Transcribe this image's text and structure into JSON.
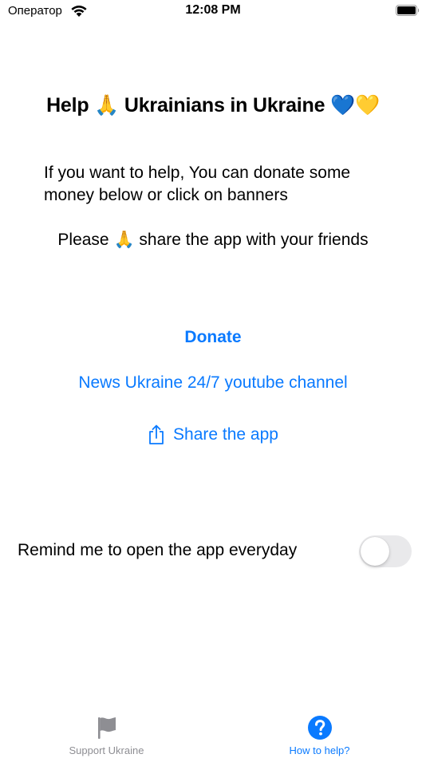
{
  "status_bar": {
    "carrier": "Оператор",
    "time": "12:08 PM",
    "wifi_icon": "wifi-icon",
    "battery_icon": "battery-icon"
  },
  "content": {
    "headline": "Help 🙏 Ukrainians in Ukraine 💙💛",
    "intro": "If you want to help, You can donate some money below or click on banners",
    "share_hint": "Please 🙏 share the app with your friends",
    "donate_label": "Donate",
    "news_label": "News Ukraine 24/7 youtube channel",
    "share_label": "Share the app",
    "share_icon": "share-icon"
  },
  "reminder": {
    "label": "Remind me to open the app everyday",
    "enabled": false
  },
  "tab_bar": {
    "tabs": [
      {
        "label": "Support Ukraine",
        "icon": "flag-icon",
        "selected": false
      },
      {
        "label": "How to help?",
        "icon": "question-mark-icon",
        "selected": true
      }
    ]
  },
  "colors": {
    "accent": "#0a7aff",
    "inactive": "#8e8e93",
    "toggle_off": "#e9e9eb"
  }
}
